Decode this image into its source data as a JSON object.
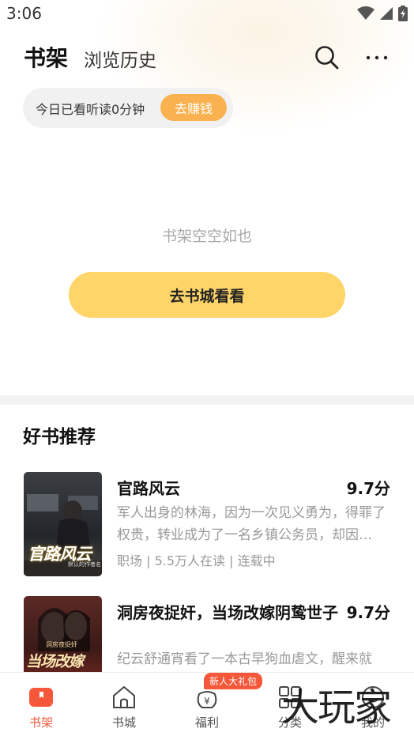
{
  "status_bar": {
    "time": "3:06"
  },
  "header": {
    "tabs": [
      {
        "label": "书架",
        "active": true
      },
      {
        "label": "浏览历史",
        "active": false
      }
    ]
  },
  "reading_banner": {
    "text": "今日已看听读0分钟",
    "button_label": "去赚钱"
  },
  "empty_state": {
    "message": "书架空空如也",
    "button_label": "去书城看看"
  },
  "recommendations": {
    "title": "好书推荐",
    "books": [
      {
        "title": "官路风云",
        "score": "9.7分",
        "description": "军人出身的林海，因为一次见义勇为，得罪了权贵，转业成为了一名乡镇公务员，却因…",
        "meta": "职场 | 5.5万人在读 | 连载中",
        "cover_text": "官路风云",
        "cover_sub": "默认的作者名"
      },
      {
        "title": "洞房夜捉奸，当场改嫁阴鸷世子",
        "score": "9.7分",
        "description": "纪云舒通宵看了一本古早狗血虐文，醒来就",
        "cover_text": "当场改嫁",
        "cover_sub": "洞房夜捉奸"
      }
    ]
  },
  "bottom_nav": {
    "items": [
      {
        "label": "书架",
        "icon": "bookshelf-icon",
        "active": true
      },
      {
        "label": "书城",
        "icon": "store-icon",
        "active": false
      },
      {
        "label": "福利",
        "icon": "welfare-icon",
        "active": false
      },
      {
        "label": "分类",
        "icon": "category-icon",
        "active": false
      },
      {
        "label": "我的",
        "icon": "profile-icon",
        "active": false
      }
    ],
    "badge": "新人大礼包"
  },
  "watermark": "大玩家",
  "colors": {
    "accent": "#f4573a",
    "earn_button": "#f9b24f",
    "store_button": "#ffd469"
  }
}
